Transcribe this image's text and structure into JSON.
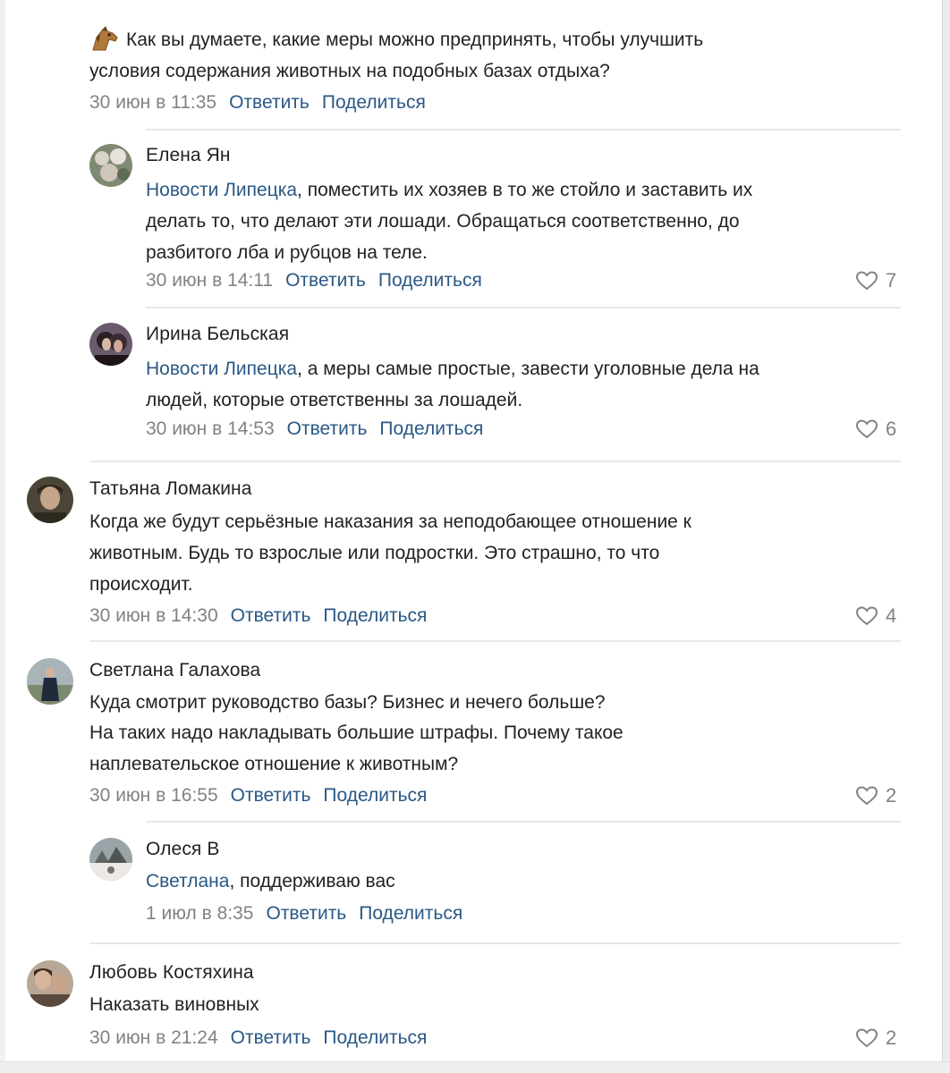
{
  "post": {
    "question_line1": "Как вы думаете, какие меры можно предпринять, чтобы улучшить",
    "question_line2": "условия содержания животных на подобных базах отдыха?",
    "time": "30 июн в 11:35",
    "reply_label": "Ответить",
    "share_label": "Поделиться",
    "emoji_icon": "horse-face-icon"
  },
  "comments": [
    {
      "author": "Елена Ян",
      "mention": "Новости Липецка",
      "line1_rest": ", поместить их хозяев в то же стойло и заставить их",
      "line2": "делать то, что делают эти лошади. Обращаться соответственно, до",
      "line3": "разбитого лба и рубцов на теле.",
      "time": "30 июн в 14:11",
      "likes": "7"
    },
    {
      "author": "Ирина Бельская",
      "mention": "Новости Липецка",
      "line1_rest": ", а меры самые простые, завести уголовные дела на",
      "line2": "людей, которые ответственны за лошадей.",
      "time": "30 июн в 14:53",
      "likes": "6"
    },
    {
      "author": "Татьяна Ломакина",
      "line1": "Когда же будут серьёзные наказания за неподобающее отношение к",
      "line2": "животным. Будь то взрослые или подростки. Это страшно, то что",
      "line3": "происходит.",
      "time": "30 июн в 14:30",
      "likes": "4"
    },
    {
      "author": "Светлана Галахова",
      "line1": "Куда смотрит руководство базы? Бизнес и нечего больше?",
      "line2": "На таких надо накладывать большие штрафы. Почему такое",
      "line3": "наплевательское отношение к животным?",
      "time": "30 июн в 16:55",
      "likes": "2"
    },
    {
      "author": "Олеся В",
      "mention": "Светлана",
      "line1_rest": ", поддерживаю вас",
      "time": "1 июл в 8:35"
    },
    {
      "author": "Любовь Костяхина",
      "line1": "Наказать виновных",
      "time": "30 июн в 21:24",
      "likes": "2"
    }
  ],
  "actions": {
    "reply": "Ответить",
    "share": "Поделиться"
  },
  "icons": {
    "like": "heart-outline-icon",
    "avatar": "avatar"
  },
  "colors": {
    "link": "#2a5885",
    "meta": "#828282",
    "divider": "#e7e8ec"
  }
}
